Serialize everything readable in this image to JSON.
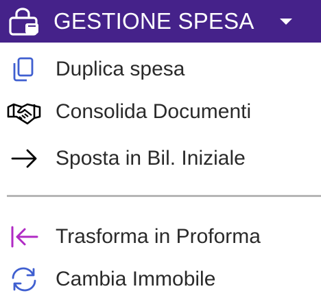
{
  "header": {
    "icon": "shopping-bag-icon",
    "title": "GESTIONE SPESA",
    "caret_icon": "caret-down-icon",
    "background_color": "#45228a",
    "text_color": "#ffffff"
  },
  "menu": {
    "items": [
      {
        "label": "Duplica spesa",
        "icon": "copy-icon",
        "icon_color": "#3f5fd0"
      },
      {
        "label": "Consolida Documenti",
        "icon": "handshake-icon",
        "icon_color": "#000000"
      },
      {
        "label": "Sposta in Bil. Iniziale",
        "icon": "arrow-right-icon",
        "icon_color": "#000000"
      },
      {
        "label": "Trasforma in Proforma",
        "icon": "arrow-left-to-bar-icon",
        "icon_color": "#b02ac4"
      },
      {
        "label": "Cambia Immobile",
        "icon": "sync-icon",
        "icon_color": "#3f5fd0"
      }
    ]
  }
}
